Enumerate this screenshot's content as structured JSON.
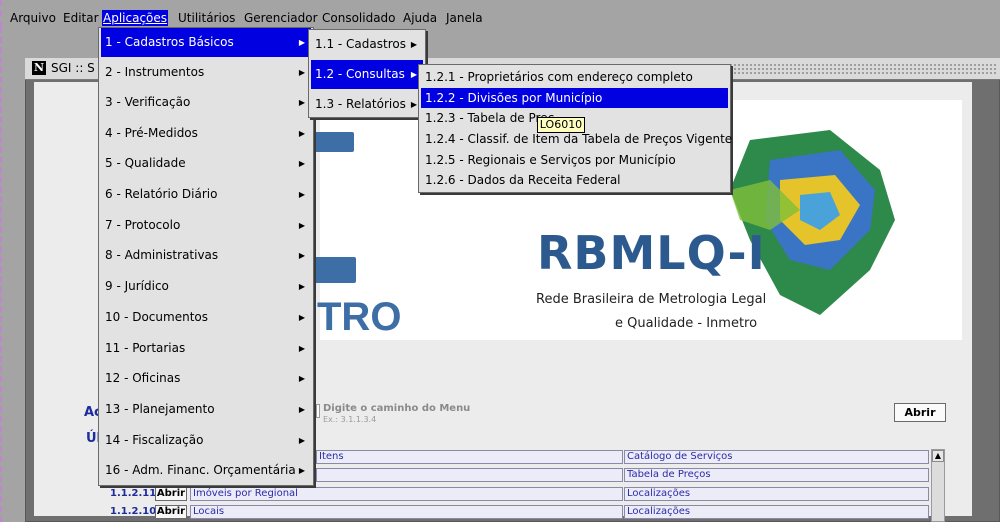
{
  "menubar": {
    "items": [
      "Arquivo",
      "Editar",
      "Aplicações",
      "Utilitários",
      "Gerenciador",
      "Consolidado",
      "Ajuda",
      "Janela"
    ]
  },
  "inner_window": {
    "title": "SGI :: S"
  },
  "main_menu": {
    "items": [
      "1 - Cadastros Básicos",
      "2 - Instrumentos",
      "3 - Verificação",
      "4 - Pré-Medidos",
      "5 - Qualidade",
      "6 - Relatório Diário",
      "7 - Protocolo",
      "8 - Administrativas",
      "9 - Jurídico",
      "10 - Documentos",
      "11 - Portarias",
      "12 - Oficinas",
      "13 - Planejamento",
      "14 - Fiscalização",
      "16 - Adm. Financ. Orçamentária"
    ]
  },
  "submenu_1": {
    "items": [
      "1.1 - Cadastros",
      "1.2 - Consultas",
      "1.3 - Relatórios"
    ]
  },
  "submenu_2": {
    "items": [
      "1.2.1 - Proprietários com endereço completo",
      "1.2.2 - Divisões por Município",
      "1.2.3 - Tabela de Preç",
      "1.2.4 - Classif. de Item da Tabela de Preços Vigente",
      "1.2.5 - Regionais e Serviços por Município",
      "1.2.6 - Dados da Receita Federal"
    ]
  },
  "tooltip": "LO6010",
  "logo": {
    "rbmlq": "RBMLQ-I",
    "subtitle1": "Rede Brasileira de Metrologia Legal",
    "subtitle2": "e Qualidade - Inmetro",
    "tro": "TRO"
  },
  "access": {
    "label": "Ac",
    "recent_label": "Úl",
    "path_hint": "Digite o caminho do Menu",
    "path_example": "Ex.: 3.1.1.3.4",
    "open_button": "Abrir"
  },
  "recent_rows": [
    {
      "code": "",
      "btn": "",
      "name": "Itens",
      "group": "Catálogo de Serviços"
    },
    {
      "code": "",
      "btn": "",
      "name": "",
      "group": "Tabela de Preços"
    },
    {
      "code": "1.1.2.11",
      "btn": "Abrir",
      "name": "Imóveis por Regional",
      "group": "Localizações"
    },
    {
      "code": "1.1.2.10",
      "btn": "Abrir",
      "name": "Locais",
      "group": "Localizações"
    }
  ],
  "colors": {
    "menu_highlight": "#0000e0",
    "logo_blue": "#2d5a8e",
    "link_blue": "#1b2c9c"
  }
}
